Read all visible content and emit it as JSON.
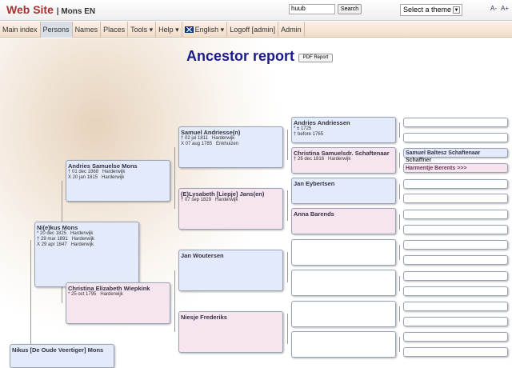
{
  "header": {
    "site": "Web Site",
    "family": "| Mons EN",
    "search_value": "huub",
    "search_button": "Search",
    "theme_select": "Select a theme",
    "font_smaller": "A-",
    "font_larger": "A+"
  },
  "nav": [
    "Main index",
    "Persons",
    "Names",
    "Places",
    "Tools ▾",
    "Help ▾",
    "English ▾",
    "Logoff [admin]",
    "Admin"
  ],
  "page": {
    "title": "Ancestor report",
    "pdf_button": "PDF Report"
  },
  "people": {
    "g1": {
      "name": "Nikus [De Oude Veertiger] Mons"
    },
    "g2": {
      "name": "Ni(e)kus Mons",
      "l1": "* 20 dec 1825   Harderwijk",
      "l2": "† 29 mar 1891   Harderwijk",
      "l3": "X 29 apr 1847   Harderwijk"
    },
    "g3a": {
      "name": "Andries Samuelse Mons",
      "l1": "† 01 dec 1868   Harderwijk",
      "l2": "X 20 jan 1815   Harderwijk"
    },
    "g3b": {
      "name": "Christina Elizabeth Wiepkink",
      "l1": "* 25 oct 1795   Harderwijk"
    },
    "g4a": {
      "name": "Samuel Andriesse(n)",
      "l1": "† 02 jul 1811   Harderwijk",
      "l2": "X 07 aug 1785   Enkhuizen"
    },
    "g4b": {
      "name": "(E)Lysabeth [Liepje] Jans(en)",
      "l1": "† 07 sep 1829   Harderwijk"
    },
    "g4c": {
      "name": "Jan Woutersen"
    },
    "g4d": {
      "name": "Niesje Frederiks"
    },
    "g5a": {
      "name": "Andries Andriessen",
      "l1": "* ± 1725",
      "l2": "† before 1765"
    },
    "g5b": {
      "name": "Christina Samuelsdr. Schaftenaar",
      "l1": "† 26 dec 1816   Harderwijk"
    },
    "g5c": {
      "name": "Jan Eybertsen"
    },
    "g5d": {
      "name": "Anna Barends"
    },
    "g6c": {
      "name": "Samuel Baltesz Schaftenaar Schaffner"
    },
    "g6d": {
      "name": "Harmentje Berents >>>"
    }
  }
}
